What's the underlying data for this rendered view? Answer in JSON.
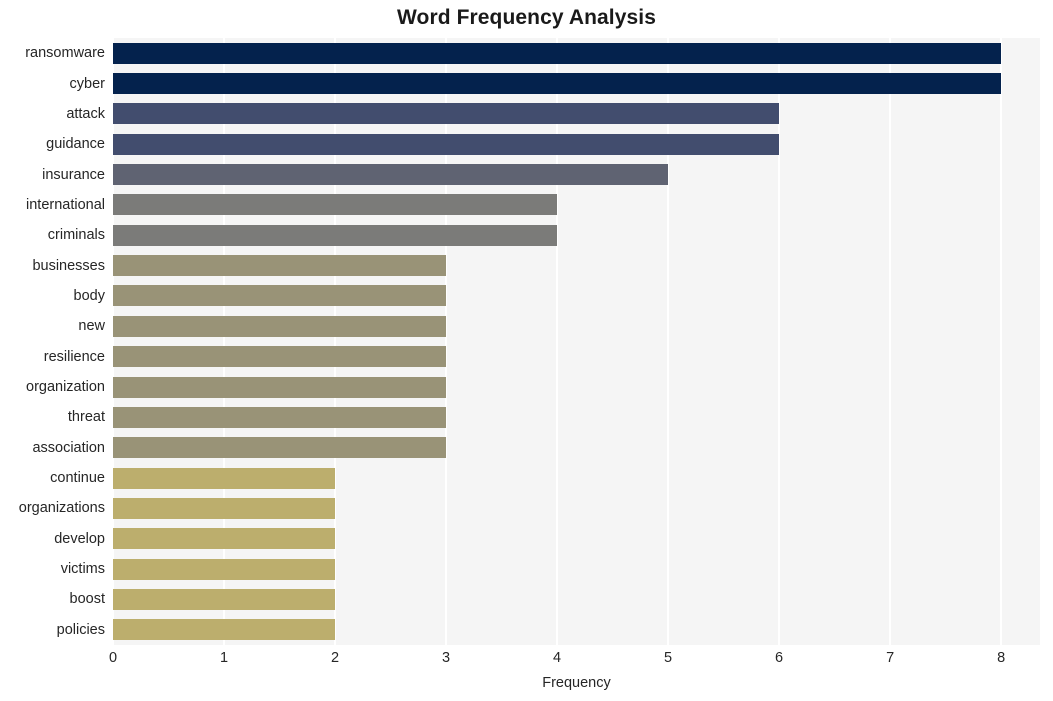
{
  "chart_data": {
    "type": "bar",
    "orientation": "horizontal",
    "title": "Word Frequency Analysis",
    "xlabel": "Frequency",
    "ylabel": "",
    "xlim": [
      0,
      8.35
    ],
    "ylim": null,
    "grid": true,
    "legend": false,
    "legend_position": "none",
    "xticks": [
      "0",
      "1",
      "2",
      "3",
      "4",
      "5",
      "6",
      "7",
      "8"
    ],
    "xtick_values": [
      0,
      1,
      2,
      3,
      4,
      5,
      6,
      7,
      8
    ],
    "categories": [
      "ransomware",
      "cyber",
      "attack",
      "guidance",
      "insurance",
      "international",
      "criminals",
      "businesses",
      "body",
      "new",
      "resilience",
      "organization",
      "threat",
      "association",
      "continue",
      "organizations",
      "develop",
      "victims",
      "boost",
      "policies"
    ],
    "values": [
      8,
      8,
      6,
      6,
      5,
      4,
      4,
      3,
      3,
      3,
      3,
      3,
      3,
      3,
      2,
      2,
      2,
      2,
      2,
      2
    ],
    "bar_colors": [
      "#04224d",
      "#04224d",
      "#424d6e",
      "#424d6e",
      "#5f6372",
      "#7b7b79",
      "#7b7b79",
      "#999377",
      "#999377",
      "#999377",
      "#999377",
      "#999377",
      "#999377",
      "#999377",
      "#bcae6d",
      "#bcae6d",
      "#bcae6d",
      "#bcae6d",
      "#bcae6d",
      "#bcae6d"
    ]
  },
  "style": {
    "plot_background": "#f5f5f5",
    "figure_background": "#ffffff",
    "gridline_color": "#ffffff",
    "text_color": "#262626",
    "title_color": "#1a1a1a"
  }
}
